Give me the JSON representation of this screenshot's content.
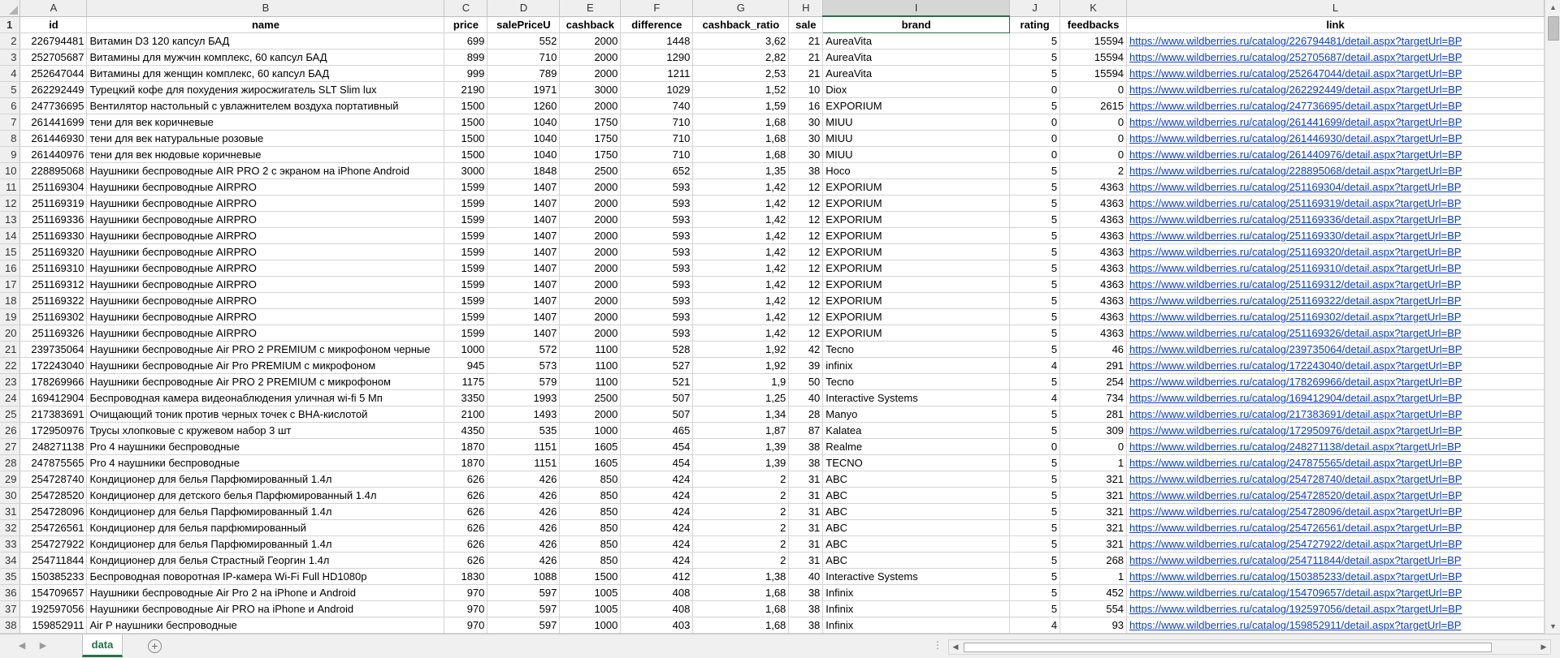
{
  "columns": [
    {
      "letter": "A"
    },
    {
      "letter": "B"
    },
    {
      "letter": "C"
    },
    {
      "letter": "D"
    },
    {
      "letter": "E"
    },
    {
      "letter": "F"
    },
    {
      "letter": "G"
    },
    {
      "letter": "H"
    },
    {
      "letter": "I"
    },
    {
      "letter": "J"
    },
    {
      "letter": "K"
    },
    {
      "letter": "L"
    }
  ],
  "selected_column": "I",
  "header_row": {
    "row_number": "1",
    "cells": [
      "id",
      "name",
      "price",
      "salePriceU",
      "cashback",
      "difference",
      "cashback_ratio",
      "sale",
      "brand",
      "rating",
      "feedbacks",
      "link"
    ]
  },
  "rows": [
    {
      "n": "2",
      "c": [
        "226794481",
        "Витамин D3 120 капсул БАД",
        "699",
        "552",
        "2000",
        "1448",
        "3,62",
        "21",
        "AureaVita",
        "5",
        "15594",
        "https://www.wildberries.ru/catalog/226794481/detail.aspx?targetUrl=BP"
      ]
    },
    {
      "n": "3",
      "c": [
        "252705687",
        "Витамины для мужчин комплекс, 60 капсул БАД",
        "899",
        "710",
        "2000",
        "1290",
        "2,82",
        "21",
        "AureaVita",
        "5",
        "15594",
        "https://www.wildberries.ru/catalog/252705687/detail.aspx?targetUrl=BP"
      ]
    },
    {
      "n": "4",
      "c": [
        "252647044",
        "Витамины для женщин комплекс, 60 капсул БАД",
        "999",
        "789",
        "2000",
        "1211",
        "2,53",
        "21",
        "AureaVita",
        "5",
        "15594",
        "https://www.wildberries.ru/catalog/252647044/detail.aspx?targetUrl=BP"
      ]
    },
    {
      "n": "5",
      "c": [
        "262292449",
        "Турецкий кофе для похудения жиросжигатель SLT Slim lux",
        "2190",
        "1971",
        "3000",
        "1029",
        "1,52",
        "10",
        "Diox",
        "0",
        "0",
        "https://www.wildberries.ru/catalog/262292449/detail.aspx?targetUrl=BP"
      ]
    },
    {
      "n": "6",
      "c": [
        "247736695",
        "Вентилятор настольный с увлажнителем воздуха портативный",
        "1500",
        "1260",
        "2000",
        "740",
        "1,59",
        "16",
        "EXPORIUM",
        "5",
        "2615",
        "https://www.wildberries.ru/catalog/247736695/detail.aspx?targetUrl=BP"
      ]
    },
    {
      "n": "7",
      "c": [
        "261441699",
        "тени для век коричневые",
        "1500",
        "1040",
        "1750",
        "710",
        "1,68",
        "30",
        "MIUU",
        "0",
        "0",
        "https://www.wildberries.ru/catalog/261441699/detail.aspx?targetUrl=BP"
      ]
    },
    {
      "n": "8",
      "c": [
        "261446930",
        "тени для век натуральные розовые",
        "1500",
        "1040",
        "1750",
        "710",
        "1,68",
        "30",
        "MIUU",
        "0",
        "0",
        "https://www.wildberries.ru/catalog/261446930/detail.aspx?targetUrl=BP"
      ]
    },
    {
      "n": "9",
      "c": [
        "261440976",
        "тени для век нюдовые коричневые",
        "1500",
        "1040",
        "1750",
        "710",
        "1,68",
        "30",
        "MIUU",
        "0",
        "0",
        "https://www.wildberries.ru/catalog/261440976/detail.aspx?targetUrl=BP"
      ]
    },
    {
      "n": "10",
      "c": [
        "228895068",
        "Наушники беспроводные AIR PRO 2 с экраном на iPhone Android",
        "3000",
        "1848",
        "2500",
        "652",
        "1,35",
        "38",
        "Hoco",
        "5",
        "2",
        "https://www.wildberries.ru/catalog/228895068/detail.aspx?targetUrl=BP"
      ]
    },
    {
      "n": "11",
      "c": [
        "251169304",
        "Наушники беспроводные AIRPRO",
        "1599",
        "1407",
        "2000",
        "593",
        "1,42",
        "12",
        "EXPORIUM",
        "5",
        "4363",
        "https://www.wildberries.ru/catalog/251169304/detail.aspx?targetUrl=BP"
      ]
    },
    {
      "n": "12",
      "c": [
        "251169319",
        "Наушники беспроводные AIRPRO",
        "1599",
        "1407",
        "2000",
        "593",
        "1,42",
        "12",
        "EXPORIUM",
        "5",
        "4363",
        "https://www.wildberries.ru/catalog/251169319/detail.aspx?targetUrl=BP"
      ]
    },
    {
      "n": "13",
      "c": [
        "251169336",
        "Наушники беспроводные AIRPRO",
        "1599",
        "1407",
        "2000",
        "593",
        "1,42",
        "12",
        "EXPORIUM",
        "5",
        "4363",
        "https://www.wildberries.ru/catalog/251169336/detail.aspx?targetUrl=BP"
      ]
    },
    {
      "n": "14",
      "c": [
        "251169330",
        "Наушники беспроводные AIRPRO",
        "1599",
        "1407",
        "2000",
        "593",
        "1,42",
        "12",
        "EXPORIUM",
        "5",
        "4363",
        "https://www.wildberries.ru/catalog/251169330/detail.aspx?targetUrl=BP"
      ]
    },
    {
      "n": "15",
      "c": [
        "251169320",
        "Наушники беспроводные AIRPRO",
        "1599",
        "1407",
        "2000",
        "593",
        "1,42",
        "12",
        "EXPORIUM",
        "5",
        "4363",
        "https://www.wildberries.ru/catalog/251169320/detail.aspx?targetUrl=BP"
      ]
    },
    {
      "n": "16",
      "c": [
        "251169310",
        "Наушники беспроводные AIRPRO",
        "1599",
        "1407",
        "2000",
        "593",
        "1,42",
        "12",
        "EXPORIUM",
        "5",
        "4363",
        "https://www.wildberries.ru/catalog/251169310/detail.aspx?targetUrl=BP"
      ]
    },
    {
      "n": "17",
      "c": [
        "251169312",
        "Наушники беспроводные AIRPRO",
        "1599",
        "1407",
        "2000",
        "593",
        "1,42",
        "12",
        "EXPORIUM",
        "5",
        "4363",
        "https://www.wildberries.ru/catalog/251169312/detail.aspx?targetUrl=BP"
      ]
    },
    {
      "n": "18",
      "c": [
        "251169322",
        "Наушники беспроводные AIRPRO",
        "1599",
        "1407",
        "2000",
        "593",
        "1,42",
        "12",
        "EXPORIUM",
        "5",
        "4363",
        "https://www.wildberries.ru/catalog/251169322/detail.aspx?targetUrl=BP"
      ]
    },
    {
      "n": "19",
      "c": [
        "251169302",
        "Наушники беспроводные AIRPRO",
        "1599",
        "1407",
        "2000",
        "593",
        "1,42",
        "12",
        "EXPORIUM",
        "5",
        "4363",
        "https://www.wildberries.ru/catalog/251169302/detail.aspx?targetUrl=BP"
      ]
    },
    {
      "n": "20",
      "c": [
        "251169326",
        "Наушники беспроводные AIRPRO",
        "1599",
        "1407",
        "2000",
        "593",
        "1,42",
        "12",
        "EXPORIUM",
        "5",
        "4363",
        "https://www.wildberries.ru/catalog/251169326/detail.aspx?targetUrl=BP"
      ]
    },
    {
      "n": "21",
      "c": [
        "239735064",
        "Наушники беспроводные Air PRO 2 PREMIUM с микрофоном черные",
        "1000",
        "572",
        "1100",
        "528",
        "1,92",
        "42",
        "Tecno",
        "5",
        "46",
        "https://www.wildberries.ru/catalog/239735064/detail.aspx?targetUrl=BP"
      ]
    },
    {
      "n": "22",
      "c": [
        "172243040",
        "Наушники беспроводные Air Pro PREMIUM с микрофоном",
        "945",
        "573",
        "1100",
        "527",
        "1,92",
        "39",
        "infinix",
        "4",
        "291",
        "https://www.wildberries.ru/catalog/172243040/detail.aspx?targetUrl=BP"
      ]
    },
    {
      "n": "23",
      "c": [
        "178269966",
        "Наушники беспроводные Air PRO 2 PREMIUM с микрофоном",
        "1175",
        "579",
        "1100",
        "521",
        "1,9",
        "50",
        "Tecno",
        "5",
        "254",
        "https://www.wildberries.ru/catalog/178269966/detail.aspx?targetUrl=BP"
      ]
    },
    {
      "n": "24",
      "c": [
        "169412904",
        "Беспроводная камера видеонаблюдения уличная wi-fi 5 Мп",
        "3350",
        "1993",
        "2500",
        "507",
        "1,25",
        "40",
        "Interactive Systems",
        "4",
        "734",
        "https://www.wildberries.ru/catalog/169412904/detail.aspx?targetUrl=BP"
      ]
    },
    {
      "n": "25",
      "c": [
        "217383691",
        "Очищающий тоник против черных точек с BHA-кислотой",
        "2100",
        "1493",
        "2000",
        "507",
        "1,34",
        "28",
        "Manyo",
        "5",
        "281",
        "https://www.wildberries.ru/catalog/217383691/detail.aspx?targetUrl=BP"
      ]
    },
    {
      "n": "26",
      "c": [
        "172950976",
        "Трусы хлопковые с кружевом набор 3 шт",
        "4350",
        "535",
        "1000",
        "465",
        "1,87",
        "87",
        "Kalatea",
        "5",
        "309",
        "https://www.wildberries.ru/catalog/172950976/detail.aspx?targetUrl=BP"
      ]
    },
    {
      "n": "27",
      "c": [
        "248271138",
        "Pro 4 наушники беспроводные",
        "1870",
        "1151",
        "1605",
        "454",
        "1,39",
        "38",
        "Realme",
        "0",
        "0",
        "https://www.wildberries.ru/catalog/248271138/detail.aspx?targetUrl=BP"
      ]
    },
    {
      "n": "28",
      "c": [
        "247875565",
        "Pro 4 наушники беспроводные",
        "1870",
        "1151",
        "1605",
        "454",
        "1,39",
        "38",
        "TECNO",
        "5",
        "1",
        "https://www.wildberries.ru/catalog/247875565/detail.aspx?targetUrl=BP"
      ]
    },
    {
      "n": "29",
      "c": [
        "254728740",
        "Кондиционер для белья Парфюмированный 1.4л",
        "626",
        "426",
        "850",
        "424",
        "2",
        "31",
        "ABC",
        "5",
        "321",
        "https://www.wildberries.ru/catalog/254728740/detail.aspx?targetUrl=BP"
      ]
    },
    {
      "n": "30",
      "c": [
        "254728520",
        "Кондиционер для детского белья Парфюмированный 1.4л",
        "626",
        "426",
        "850",
        "424",
        "2",
        "31",
        "ABC",
        "5",
        "321",
        "https://www.wildberries.ru/catalog/254728520/detail.aspx?targetUrl=BP"
      ]
    },
    {
      "n": "31",
      "c": [
        "254728096",
        "Кондиционер для белья Парфюмированный 1.4л",
        "626",
        "426",
        "850",
        "424",
        "2",
        "31",
        "ABC",
        "5",
        "321",
        "https://www.wildberries.ru/catalog/254728096/detail.aspx?targetUrl=BP"
      ]
    },
    {
      "n": "32",
      "c": [
        "254726561",
        "Кондиционер для белья парфюмированный",
        "626",
        "426",
        "850",
        "424",
        "2",
        "31",
        "ABC",
        "5",
        "321",
        "https://www.wildberries.ru/catalog/254726561/detail.aspx?targetUrl=BP"
      ]
    },
    {
      "n": "33",
      "c": [
        "254727922",
        "Кондиционер для белья Парфюмированный 1.4л",
        "626",
        "426",
        "850",
        "424",
        "2",
        "31",
        "ABC",
        "5",
        "321",
        "https://www.wildberries.ru/catalog/254727922/detail.aspx?targetUrl=BP"
      ]
    },
    {
      "n": "34",
      "c": [
        "254711844",
        "Кондиционер для белья Страстный Георгин 1.4л",
        "626",
        "426",
        "850",
        "424",
        "2",
        "31",
        "ABC",
        "5",
        "268",
        "https://www.wildberries.ru/catalog/254711844/detail.aspx?targetUrl=BP"
      ]
    },
    {
      "n": "35",
      "c": [
        "150385233",
        "Беспроводная поворотная IP-камера Wi-Fi Full HD1080p",
        "1830",
        "1088",
        "1500",
        "412",
        "1,38",
        "40",
        "Interactive Systems",
        "5",
        "1",
        "https://www.wildberries.ru/catalog/150385233/detail.aspx?targetUrl=BP"
      ]
    },
    {
      "n": "36",
      "c": [
        "154709657",
        "Наушники беспроводные Air Pro 2 на iPhone и Android",
        "970",
        "597",
        "1005",
        "408",
        "1,68",
        "38",
        "Infinix",
        "5",
        "452",
        "https://www.wildberries.ru/catalog/154709657/detail.aspx?targetUrl=BP"
      ]
    },
    {
      "n": "37",
      "c": [
        "192597056",
        "Наушники беспроводные Air PRO на iPhone и Android",
        "970",
        "597",
        "1005",
        "408",
        "1,68",
        "38",
        "Infinix",
        "5",
        "554",
        "https://www.wildberries.ru/catalog/192597056/detail.aspx?targetUrl=BP"
      ]
    },
    {
      "n": "38",
      "c": [
        "159852911",
        "Air P наушники беспроводные",
        "970",
        "597",
        "1000",
        "403",
        "1,68",
        "38",
        "Infinix",
        "4",
        "93",
        "https://www.wildberries.ru/catalog/159852911/detail.aspx?targetUrl=BP"
      ]
    }
  ],
  "sheet_tab": {
    "label": "data"
  },
  "add_sheet_label": "+",
  "nav": {
    "prev": "◀",
    "next": "▶"
  },
  "options_dots": "⋮",
  "colors": {
    "accent": "#217346",
    "link": "#0b3fcf",
    "header_bg": "#efefef"
  }
}
